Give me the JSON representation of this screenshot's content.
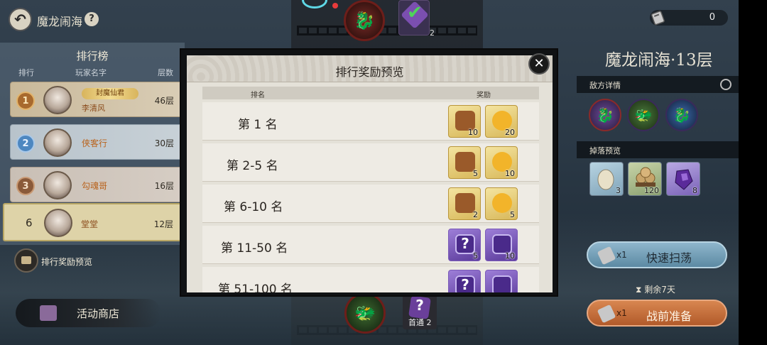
{
  "header": {
    "title": "魔龙闹海",
    "back_icon": "back-arrow-icon",
    "help_label": "?"
  },
  "currency": {
    "icon": "ticket-icon",
    "value": "0"
  },
  "top_badge": {
    "count": "2"
  },
  "ranking": {
    "title": "排行榜",
    "columns": [
      "排行",
      "玩家名字",
      "层数"
    ],
    "rows": [
      {
        "rank": "1",
        "name": "李清风",
        "title_badge": "封魔仙君",
        "floor": "46层"
      },
      {
        "rank": "2",
        "name": "侠客行",
        "floor": "30层"
      },
      {
        "rank": "3",
        "name": "勾魂哥",
        "floor": "16层"
      }
    ],
    "me": {
      "rank": "6",
      "name": "堂堂",
      "floor": "12层"
    }
  },
  "reward_preview_button": "排行奖励预览",
  "shop_button": "活动商店",
  "first_clear": {
    "label": "首通",
    "count": "2"
  },
  "modal": {
    "title": "排行奖励预览",
    "columns": [
      "排名",
      "奖励"
    ],
    "rows": [
      {
        "rank": "第 1 名",
        "items": [
          {
            "kind": "gold",
            "count": "10"
          },
          {
            "kind": "gold",
            "count": "20"
          }
        ]
      },
      {
        "rank": "第 2-5 名",
        "items": [
          {
            "kind": "gold",
            "count": "5"
          },
          {
            "kind": "gold",
            "count": "10"
          }
        ]
      },
      {
        "rank": "第 6-10 名",
        "items": [
          {
            "kind": "gold",
            "count": "2"
          },
          {
            "kind": "gold",
            "count": "5"
          }
        ]
      },
      {
        "rank": "第 11-50 名",
        "items": [
          {
            "kind": "purple",
            "count": "5"
          },
          {
            "kind": "purple",
            "count": "10"
          }
        ]
      },
      {
        "rank": "第 51-100 名",
        "items": [
          {
            "kind": "purple",
            "count": ""
          },
          {
            "kind": "purple",
            "count": ""
          }
        ]
      }
    ],
    "close_label": "✕"
  },
  "right_panel": {
    "floor_title": "魔龙闹海·13层",
    "enemy_section": "敌方详情",
    "drop_section": "掉落预览",
    "drops": [
      {
        "count": "3"
      },
      {
        "count": "120"
      },
      {
        "count": "8"
      }
    ],
    "sweep": {
      "multiplier": "x1",
      "label": "快速扫荡"
    },
    "remaining": "剩余7天",
    "prepare": {
      "multiplier": "x1",
      "label": "战前准备"
    }
  }
}
